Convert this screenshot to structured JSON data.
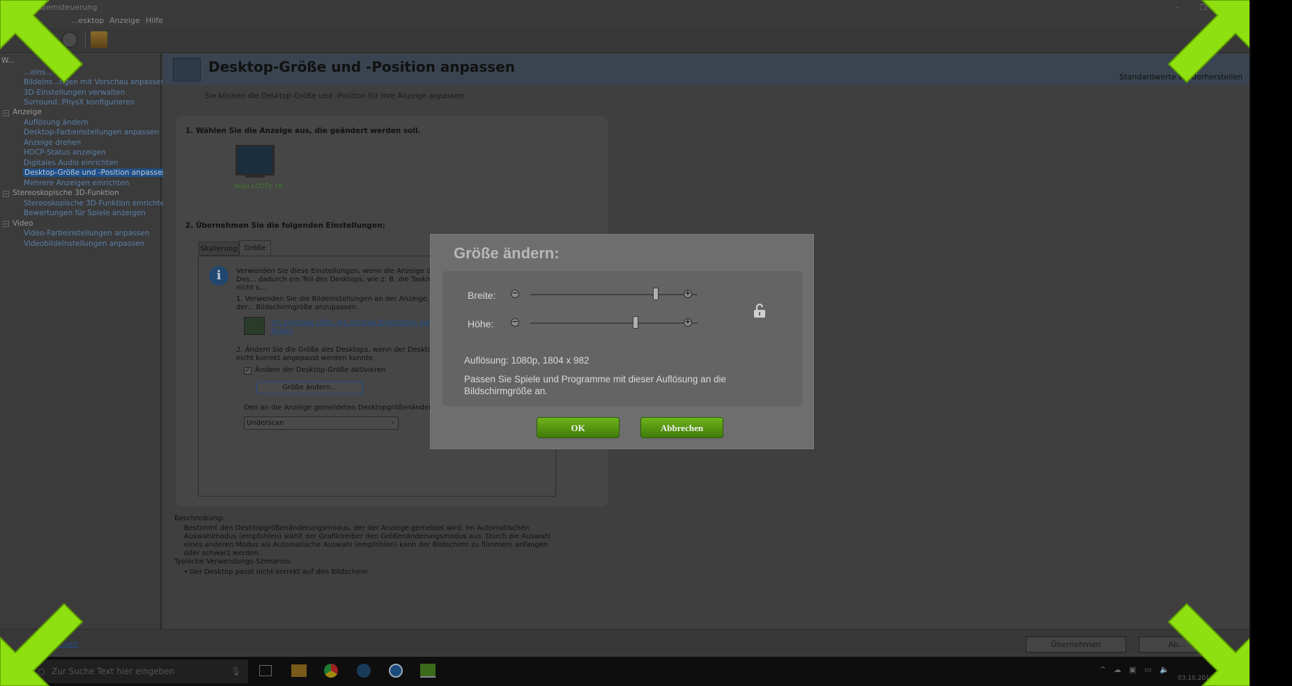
{
  "window": {
    "title": "...-Systemsteuerung",
    "menu": [
      "...esktop",
      "Anzeige",
      "Hilfe"
    ]
  },
  "sidebar": {
    "top_label": "W...",
    "items": [
      {
        "text": "...eins...",
        "kind": "link"
      },
      {
        "text": "Bildeins...ngen mit Vorschau anpassen",
        "kind": "link"
      },
      {
        "text": "3D-Einstellungen verwalten",
        "kind": "link"
      },
      {
        "text": "Surround, PhysX konfigurieren",
        "kind": "link"
      },
      {
        "text": "Anzeige",
        "kind": "cat"
      },
      {
        "text": "Auflösung ändern",
        "kind": "link"
      },
      {
        "text": "Desktop-Farbeinstellungen anpassen",
        "kind": "link"
      },
      {
        "text": "Anzeige drehen",
        "kind": "link"
      },
      {
        "text": "HDCP-Status anzeigen",
        "kind": "link"
      },
      {
        "text": "Digitales Audio einrichten",
        "kind": "link"
      },
      {
        "text": "Desktop-Größe und -Position anpassen",
        "kind": "selected"
      },
      {
        "text": "Mehrere Anzeigen einrichten",
        "kind": "link"
      },
      {
        "text": "Stereoskopische 3D-Funktion",
        "kind": "cat"
      },
      {
        "text": "Stereoskopische 3D-Funktion einrichten",
        "kind": "link"
      },
      {
        "text": "Bewertungen für Spiele anzeigen",
        "kind": "link"
      },
      {
        "text": "Video",
        "kind": "cat"
      },
      {
        "text": "Video-Farbeinstellungen anpassen",
        "kind": "link"
      },
      {
        "text": "Videobildeinstellungen anpassen",
        "kind": "link"
      }
    ],
    "bottom_link": "...nen"
  },
  "main": {
    "title": "Desktop-Größe und -Position anpassen",
    "restore": "Standardwerte wiederherstellen",
    "subtitle": "Sie können die Desktop-Größe und -Position für Ihre Anzeige anpassen.",
    "step1": "1. Wählen Sie die Anzeige aus, die geändert werden soll.",
    "display_name": "Targa LCDTV 16",
    "step2": "2. Übernehmen Sie die folgenden Einstellungen:",
    "tabs": [
      "Skalierung",
      "Größe"
    ],
    "info_text": "Verwenden Sie diese Einstellungen, wenn die Anzeige den Des... dadurch ein Teil des Desktops, wie z. B. die Taskleiste, nicht s...",
    "point1": "1. Verwenden Sie die Bildeinstellungen an der Anzeige, um der... Bildschirmgröße anzupassen.",
    "help_link": "Ich benötige Hilfe, die richtige Einstellung auf mein... finden",
    "point2": "2. Ändern Sie die Größe des Desktops, wenn der Desktop mit... nicht korrekt angepasst werden konnte.",
    "checkbox_label": "Ändern der Desktop-Größe aktivieren",
    "resize_button": "Größe ändern...",
    "mode_label": "Den an die Anzeige gemeldeten Desktopgrößenänderungsm...",
    "mode_value": "Underscan",
    "desc_label": "Beschreibung:",
    "desc_text": "Bestimmt den Desktopgrößenänderungsmodus, der der Anzeige gemeldet wird. Im Automatischen Auswahlmodus (empfohlen) wählt der Grafiktreiber den Größenänderungsmodus aus. Durch die Auswahl eines anderen Modus als Automatische Auswahl (empfohlen) kann der Bildschirm zu flimmern anfangen oder schwarz werden.",
    "usage_label": "Typische Verwendungs-Szenarios:",
    "usage_item": "Der Desktop passt nicht korrekt auf den Bildschirm"
  },
  "bottombar": {
    "apply": "Übernehmen",
    "cancel": "Ab..."
  },
  "taskbar": {
    "search_placeholder": "Zur Suche Text hier eingeben",
    "date": "03.10.2017"
  },
  "dialog": {
    "title": "Größe ändern:",
    "width_label": "Breite:",
    "height_label": "Höhe:",
    "width_level": 0.75,
    "height_level": 0.63,
    "resolution": "Auflösung: 1080p, 1804 x 982",
    "hint": "Passen Sie Spiele und Programme mit dieser Auflösung an die Bildschirmgröße an.",
    "ok": "OK",
    "cancel": "Abbrechen"
  },
  "colors": {
    "accent_green": "#6fb31a",
    "arrow_green": "#8fe010",
    "selection_blue": "#1f4f8a"
  }
}
